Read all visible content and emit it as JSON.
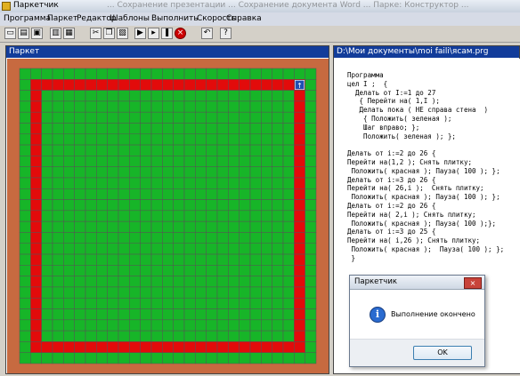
{
  "window": {
    "title": "Паркетчик",
    "background_text": "... Сохранение презентации ... Сохранение документа Word ... Парке: Конструктор ..."
  },
  "menu": [
    "Программа",
    "Паркет",
    "Редактор",
    "Шаблоны",
    "Выполнить",
    "Скорость",
    "Справка"
  ],
  "toolbar": {
    "icons": [
      "new-file-icon",
      "open-file-icon",
      "save-file-icon",
      "print-icon",
      "print-preview-icon",
      "cut-icon",
      "copy-icon",
      "paste-icon",
      "run-icon",
      "step-icon",
      "pause-icon",
      "stop-icon",
      "undo-icon",
      "help-icon"
    ],
    "help_label": "?",
    "stop_label": "×"
  },
  "parquet_panel": {
    "title": "Паркет"
  },
  "grid": {
    "size": 27,
    "robot_label": "↑",
    "colors": {
      "green": "#17b528",
      "red": "#e20b0b",
      "border": "#c76a40"
    }
  },
  "editor_panel": {
    "title": "D:\\Мои документы\\moi faili\\ясам.prg"
  },
  "code_lines": [
    "Программа",
    "цел I ;  {",
    "  Делать от I:=1 до 27",
    "   { Перейти на( 1,I );",
    "   Делать пока ( НЕ справа стена  )",
    "    { Положить( зеленая );",
    "    Шаг вправо; };",
    "    Положить( зеленая ); };",
    "",
    "Делать от i:=2 до 26 {",
    "Перейти на(1,2 ); Снять плитку;",
    " Положить( красная ); Пауза( 100 ); };",
    "Делать от i:=3 до 26 {",
    "Перейти на( 26,i );  Снять плитку;",
    " Положить( красная ); Пауза( 100 ); };",
    "Делать от i:=2 до 26 {",
    "Перейти на( 2,i ); Снять плитку;",
    " Положить( красная ); Пауза( 100 );};",
    "Делать от i:=3 до 25 {",
    "Перейти на( i,26 ); Снять плитку;",
    " Положить( красная );  Пауза( 100 ); };",
    " }"
  ],
  "dialog": {
    "title": "Паркетчик",
    "message": "Выполнение окончено",
    "ok_label": "OK",
    "close_label": "×",
    "info_label": "i"
  }
}
